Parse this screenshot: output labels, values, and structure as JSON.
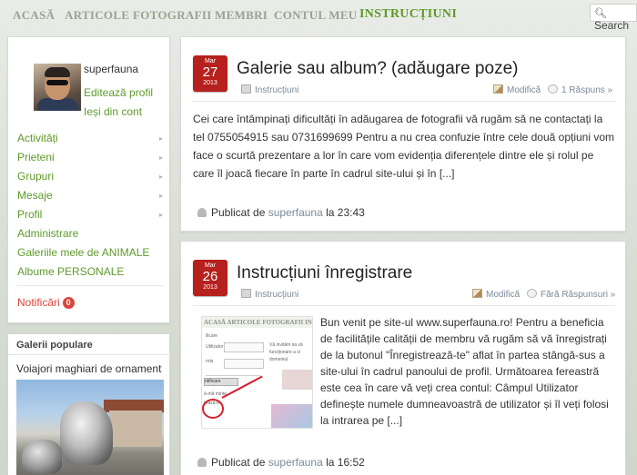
{
  "nav": {
    "items": [
      "ACASĂ",
      "ARTICOLE",
      "FOTOGRAFII",
      "MEMBRI",
      "CONTUL MEU",
      "INSTRUCȚIUNI"
    ],
    "active": "INSTRUCȚIUNI",
    "search_label": "Search",
    "search_icon": "magnifier-icon"
  },
  "profile": {
    "username": "superfauna",
    "edit_link": "Editează profil",
    "logout_link": "Ieși din cont"
  },
  "sidebar_menu": {
    "items": [
      {
        "label": "Activități",
        "arrow": "▸"
      },
      {
        "label": "Prieteni",
        "arrow": "▸"
      },
      {
        "label": "Grupuri",
        "arrow": "▸"
      },
      {
        "label": "Mesaje",
        "arrow": "▸"
      },
      {
        "label": "Profil",
        "arrow": "▸"
      },
      {
        "label": "Administrare"
      },
      {
        "label": "Galeriile mele de ANIMALE"
      },
      {
        "label": "Albume PERSONALE"
      }
    ],
    "notifications_label": "Notificări",
    "notifications_count": "0"
  },
  "popular_galleries": {
    "title": "Galerii populare",
    "caption": "Voiajori maghiari de ornament"
  },
  "posts": [
    {
      "date": {
        "month": "Mar",
        "day": "27",
        "year": "2013"
      },
      "title": "Galerie sau album? (adăugare poze)",
      "category": "Instrucțiuni",
      "edit": "Modifică",
      "comments": "1 Răspuns »",
      "excerpt": "Cei care întâmpinați dificultăți în adăugarea de fotografii vă rugăm să ne contactați la tel 0755054915 sau 0731699699 Pentru a nu crea confuzie între cele două opțiuni vom face o scurtă prezentare a lor în care vom evidenția diferențele dintre ele și rolul pe care îl joacă fiecare în parte în cadrul site-ului și în",
      "more": "[...]",
      "published_prefix": "Publicat de",
      "author": "superfauna",
      "time_prefix": "la",
      "time": "23:43"
    },
    {
      "date": {
        "month": "Mar",
        "day": "26",
        "year": "2013"
      },
      "title": "Instrucțiuni înregistrare",
      "category": "Instrucțiuni",
      "edit": "Modifică",
      "comments": "Fără Răspunsuri »",
      "excerpt": "Bun venit pe site-ul www.superfauna.ro! Pentru a beneficia de facilitățile calității de membru vă rugăm să vă înregistrați de la butonul \"Înregistrează-te\" aflat în partea stângă-sus a site-ului în cadrul panoului de profil. Următoarea fereastră este cea în care vă veți crea contul: Câmpul Utilizator definește numele dumneavoastră de utilizator și îl veți folosi la intrarea pe",
      "more": "[...]",
      "published_prefix": "Publicat de",
      "author": "superfauna",
      "time_prefix": "la",
      "time": "16:52",
      "thumb": {
        "bar": "ACASĂ   ARTICOLE   FOTOGRAFII   INSTRU",
        "t1": "ilicare",
        "t2": "Utilizator",
        "t3": "rola",
        "btn": "ntificare",
        "t4": "ă-mă minte",
        "t5": "rează-te",
        "t6": "Vă invităm sa vă",
        "t7": "funcționare a si",
        "t8": "domeniul"
      }
    }
  ]
}
